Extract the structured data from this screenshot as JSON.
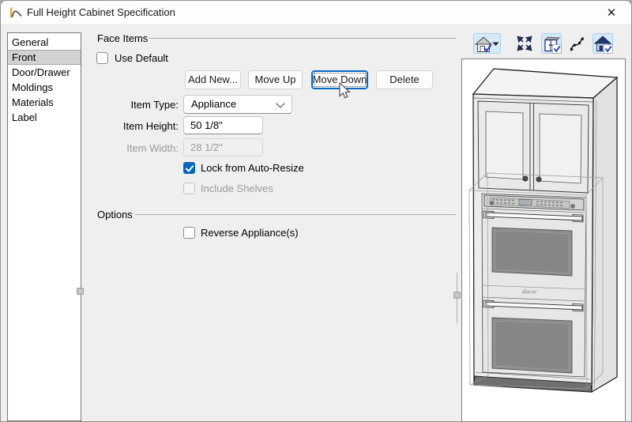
{
  "window": {
    "title": "Full Height Cabinet Specification",
    "close_glyph": "✕"
  },
  "sidebar": {
    "items": [
      {
        "label": "General",
        "selected": false
      },
      {
        "label": "Front",
        "selected": true
      },
      {
        "label": "Door/Drawer",
        "selected": false
      },
      {
        "label": "Moldings",
        "selected": false
      },
      {
        "label": "Materials",
        "selected": false
      },
      {
        "label": "Label",
        "selected": false
      }
    ]
  },
  "face_items": {
    "title": "Face Items",
    "use_default": {
      "label": "Use Default",
      "checked": false
    },
    "buttons": {
      "add_new": "Add New...",
      "move_up": "Move Up",
      "move_down": "Move Down",
      "delete": "Delete",
      "focused_button": "Move Down"
    },
    "item_type": {
      "label": "Item Type:",
      "value": "Appliance"
    },
    "item_height": {
      "label": "Item Height:",
      "value": "50 1/8\""
    },
    "item_width": {
      "label": "Item Width:",
      "value": "28 1/2\"",
      "disabled": true
    },
    "lock_auto_resize": {
      "label": "Lock from Auto-Resize",
      "checked": true
    },
    "include_shelves": {
      "label": "Include Shelves",
      "checked": false,
      "disabled": true
    }
  },
  "options": {
    "title": "Options",
    "reverse_appliance": {
      "label": "Reverse Appliance(s)",
      "checked": false
    }
  },
  "preview": {
    "toolbar_icons": [
      "standard-view-house",
      "fill-window",
      "cabinet-toggle",
      "path-arrows",
      "house-color-toggle"
    ],
    "brand_text": "dacor"
  },
  "colors": {
    "accent": "#0067c0",
    "toolbar_highlight": "#d6eaf9",
    "selection_gray": "#d2d2d2",
    "oven_glass": "#8d8d8d"
  }
}
